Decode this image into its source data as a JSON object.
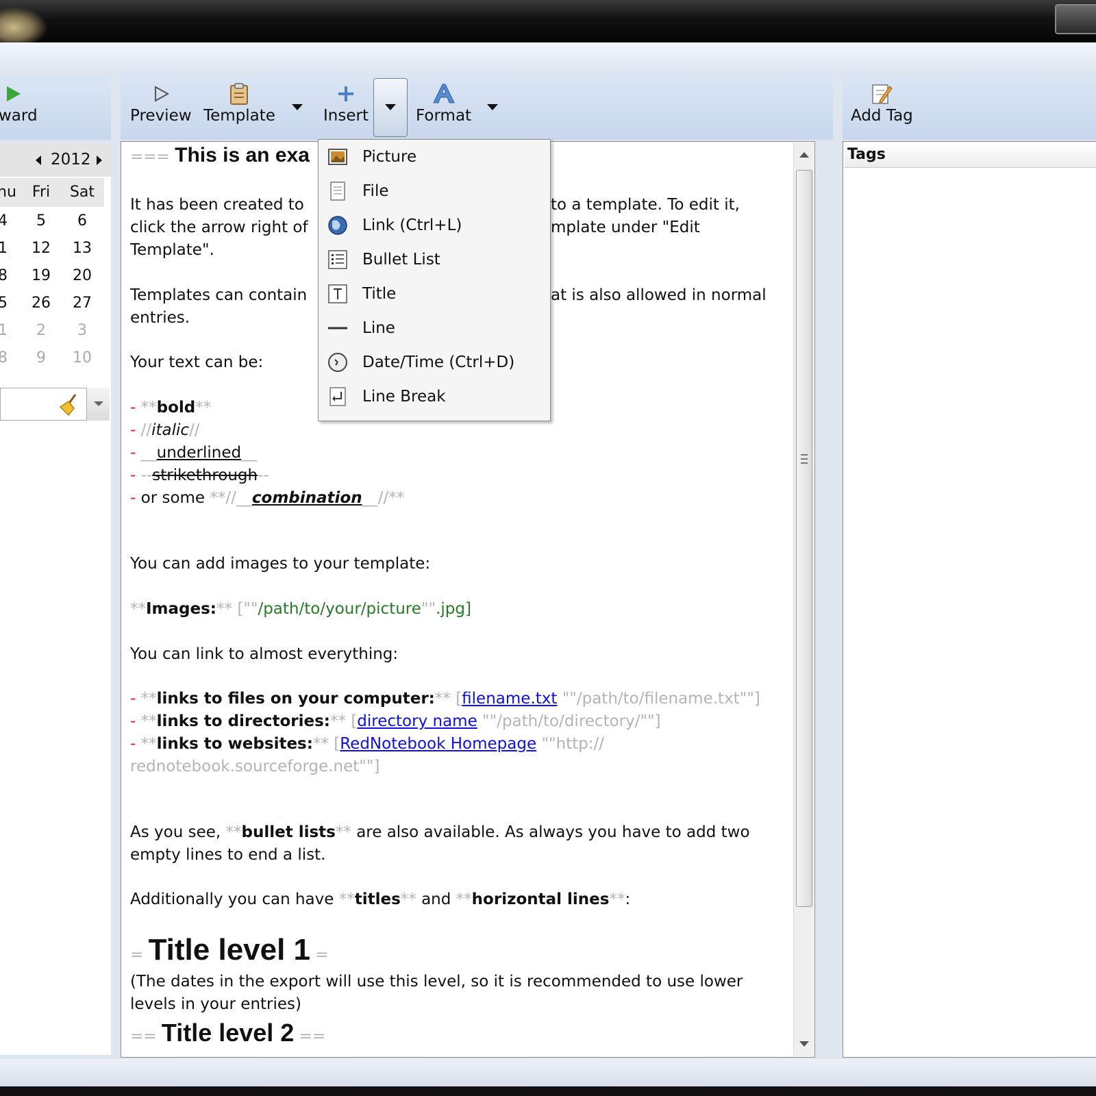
{
  "toolbar": {
    "forward_label": "ward",
    "preview_label": "Preview",
    "template_label": "Template",
    "insert_label": "Insert",
    "format_label": "Format",
    "add_tag_label": "Add Tag"
  },
  "calendar": {
    "year": "2012",
    "weekdays": [
      "hu",
      "Fri",
      "Sat"
    ],
    "rows": [
      [
        "4",
        "5",
        "6"
      ],
      [
        "1",
        "12",
        "13"
      ],
      [
        "8",
        "19",
        "20"
      ],
      [
        "5",
        "26",
        "27"
      ],
      [
        "1",
        "2",
        "3"
      ],
      [
        "8",
        "9",
        "10"
      ]
    ]
  },
  "insert_menu": {
    "items": [
      "Picture",
      "File",
      "Link (Ctrl+L)",
      "Bullet List",
      "Title",
      "Line",
      "Date/Time (Ctrl+D)",
      "Line Break"
    ]
  },
  "tags_panel": {
    "header": "Tags"
  },
  "editor": {
    "title_markup": "===",
    "title_visible": "This is an exa",
    "p1a": "It has been created to",
    "p1b": "to a template. To edit it,",
    "p1c": "click the arrow right of",
    "p1d": "mplate under \"Edit",
    "p1e": "Template\".",
    "p2a": "Templates can contain",
    "p2b": "at is also allowed in normal",
    "p2c": "entries.",
    "p3": "Your text can be:",
    "dash": "-",
    "bold_mk": "**",
    "bold": "bold",
    "italic_mk": "//",
    "italic": "italic",
    "under_mk": "__",
    "underlined": "underlined",
    "strike_mk": "--",
    "strikethrough": "strikethrough",
    "or_some": "or some",
    "combo_open": "**//__",
    "combination": "combination",
    "combo_close": "__//**",
    "img_intro": "You can add images to your template:",
    "images_label": "Images:",
    "img_open": "[\"\"",
    "img_path": "/path/to/your/picture",
    "img_mid": "\"\"",
    "img_ext": ".jpg]",
    "link_intro": "You can link to almost everything:",
    "l1_label": "links to files on your computer:",
    "l1_open": "[",
    "l1_link": "filename.txt",
    "l1_target": "\"\"/path/to/filename.txt\"\"]",
    "l2_label": "links to directories:",
    "l2_link": "directory name",
    "l2_target": "\"\"/path/to/directory/\"\"]",
    "l3_label": "links to websites:",
    "l3_link": "RedNotebook Homepage",
    "l3_target_a": "\"\"http://",
    "l3_target_b": "rednotebook.sourceforge.net\"\"]",
    "bl_a": "As you see,",
    "bl_b": "bullet lists",
    "bl_c": "are also available. As always you have to add two",
    "bl_d": "empty lines to end a list.",
    "add_a": "Additionally you can have",
    "add_titles": "titles",
    "add_and": "and",
    "add_hl": "horizontal lines",
    "add_colon": ":",
    "t1_mk": "=",
    "t1": "Title level 1",
    "t1_note_a": "(The dates in the export will use this level, so it is recommended to use lower",
    "t1_note_b": "levels in your entries)",
    "t2_mk": "==",
    "t2": "Title level 2"
  }
}
